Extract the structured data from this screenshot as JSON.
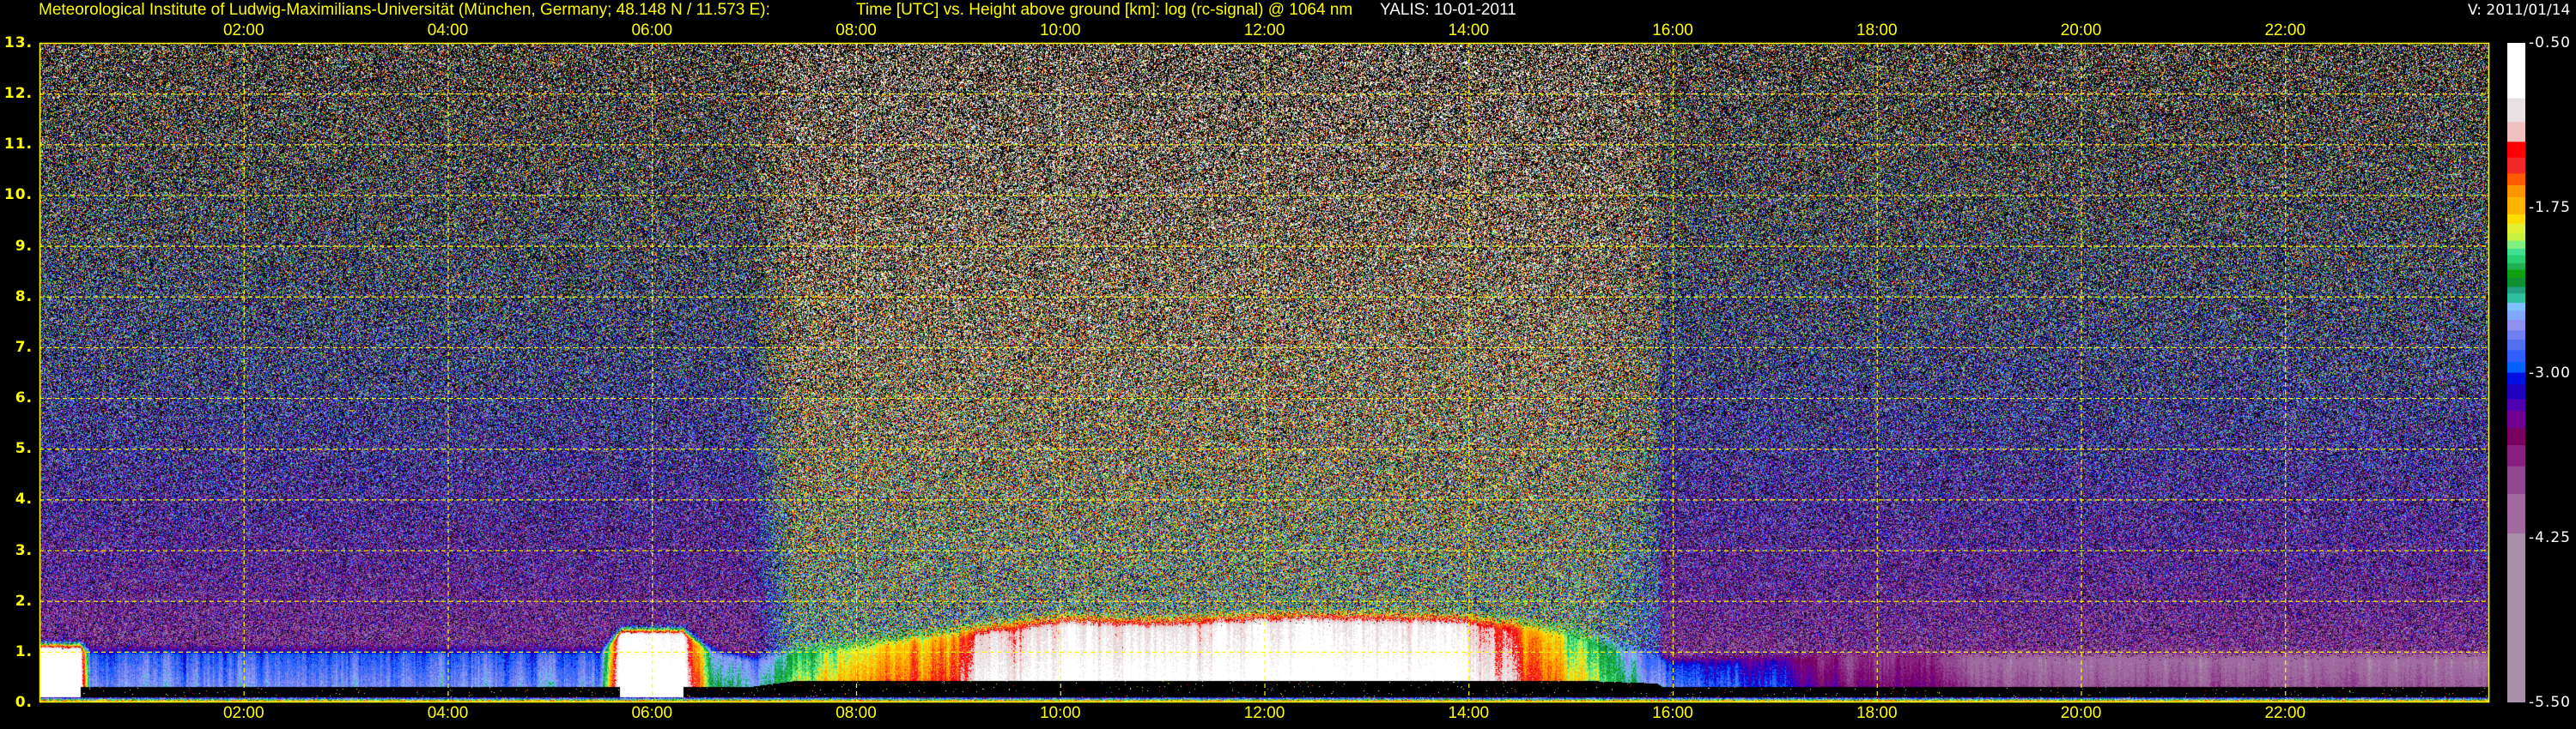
{
  "header": {
    "institute": "Meteorological Institute of Ludwig-Maximilians-Universität (München, Germany; 48.148 N / 11.573 E):",
    "title": "Time [UTC] vs. Height above ground [km]: log (rc-signal) @ 1064 nm",
    "instrument_date": "YALIS: 10-01-2011",
    "version": "V: 2011/01/14"
  },
  "chart_data": {
    "type": "heatmap",
    "title": "Time [UTC] vs. Height above ground [km]: log (rc-signal) @ 1064 nm",
    "xlabel": "Time [UTC]",
    "ylabel": "Height above ground [km]",
    "xlim": [
      0,
      24
    ],
    "ylim": [
      0,
      13
    ],
    "grid": true,
    "x_ticks": [
      {
        "value": 2,
        "label": "02:00"
      },
      {
        "value": 4,
        "label": "04:00"
      },
      {
        "value": 6,
        "label": "06:00"
      },
      {
        "value": 8,
        "label": "08:00"
      },
      {
        "value": 10,
        "label": "10:00"
      },
      {
        "value": 12,
        "label": "12:00"
      },
      {
        "value": 14,
        "label": "14:00"
      },
      {
        "value": 16,
        "label": "16:00"
      },
      {
        "value": 18,
        "label": "18:00"
      },
      {
        "value": 20,
        "label": "20:00"
      },
      {
        "value": 22,
        "label": "22:00"
      }
    ],
    "y_ticks": [
      {
        "value": 0,
        "label": "0."
      },
      {
        "value": 1,
        "label": "1."
      },
      {
        "value": 2,
        "label": "2."
      },
      {
        "value": 3,
        "label": "3."
      },
      {
        "value": 4,
        "label": "4."
      },
      {
        "value": 5,
        "label": "5."
      },
      {
        "value": 6,
        "label": "6."
      },
      {
        "value": 7,
        "label": "7."
      },
      {
        "value": 8,
        "label": "8."
      },
      {
        "value": 9,
        "label": "9."
      },
      {
        "value": 10,
        "label": "10."
      },
      {
        "value": 11,
        "label": "11."
      },
      {
        "value": 12,
        "label": "12."
      },
      {
        "value": 13,
        "label": "13."
      }
    ],
    "aerosol_layer_estimate": {
      "time_h": [
        0,
        0.4,
        0.5,
        5.5,
        5.7,
        6.3,
        6.6,
        7.0,
        7.5,
        8,
        9,
        9.2,
        10,
        11,
        12,
        13,
        14,
        14.5,
        15,
        15.5,
        16,
        16.5,
        17,
        17.5,
        18,
        18.5,
        19,
        24
      ],
      "top_km": [
        1.0,
        1.0,
        0.9,
        0.9,
        1.3,
        1.3,
        0.9,
        0.75,
        0.85,
        0.95,
        1.2,
        1.25,
        1.45,
        1.4,
        1.5,
        1.5,
        1.45,
        1.35,
        1.2,
        0.9,
        0.7,
        0.72,
        0.75,
        0.8,
        0.8,
        0.8,
        0.8,
        0.8
      ],
      "log_signal": [
        -0.6,
        -0.8,
        -2.9,
        -2.85,
        -0.7,
        -0.8,
        -2.6,
        -2.7,
        -2.1,
        -1.9,
        -1.6,
        -1.1,
        -1.0,
        -0.95,
        -0.9,
        -0.9,
        -1.0,
        -1.5,
        -2.0,
        -2.4,
        -3.0,
        -3.1,
        -3.2,
        -3.6,
        -3.7,
        -3.6,
        -4.1,
        -4.1
      ]
    },
    "colorbar": {
      "range": [
        -5.5,
        -0.5
      ],
      "tick_labels": [
        {
          "value": -0.5,
          "label": "-0.50"
        },
        {
          "value": -1.75,
          "label": "-1.75"
        },
        {
          "value": -3.0,
          "label": "-3.00"
        },
        {
          "value": -4.25,
          "label": "-4.25"
        },
        {
          "value": -5.5,
          "label": "-5.50"
        }
      ],
      "levels": [
        {
          "min": -0.92,
          "color": "#ffffff"
        },
        {
          "min": -1.1,
          "color": "#e8e0e2"
        },
        {
          "min": -1.25,
          "color": "#f0c0c0"
        },
        {
          "min": -1.37,
          "color": "#ff0000"
        },
        {
          "min": -1.49,
          "color": "#f02828"
        },
        {
          "min": -1.58,
          "color": "#ff5a00"
        },
        {
          "min": -1.67,
          "color": "#ff9600"
        },
        {
          "min": -1.8,
          "color": "#ffb400"
        },
        {
          "min": -1.87,
          "color": "#ffdc00"
        },
        {
          "min": -1.94,
          "color": "#e0f030"
        },
        {
          "min": -2.0,
          "color": "#c8f040"
        },
        {
          "min": -2.06,
          "color": "#80f080"
        },
        {
          "min": -2.11,
          "color": "#40e090"
        },
        {
          "min": -2.17,
          "color": "#28d070"
        },
        {
          "min": -2.22,
          "color": "#20b050"
        },
        {
          "min": -2.28,
          "color": "#10a010"
        },
        {
          "min": -2.35,
          "color": "#109030"
        },
        {
          "min": -2.4,
          "color": "#20a080"
        },
        {
          "min": -2.47,
          "color": "#30c0a0"
        },
        {
          "min": -2.53,
          "color": "#80c0ff"
        },
        {
          "min": -2.6,
          "color": "#80a8ff"
        },
        {
          "min": -2.68,
          "color": "#9090f0"
        },
        {
          "min": -2.75,
          "color": "#7080f0"
        },
        {
          "min": -2.83,
          "color": "#5070f0"
        },
        {
          "min": -2.92,
          "color": "#3060ff"
        },
        {
          "min": -3.0,
          "color": "#0060ff"
        },
        {
          "min": -3.09,
          "color": "#0010e0"
        },
        {
          "min": -3.2,
          "color": "#2000c0"
        },
        {
          "min": -3.29,
          "color": "#5000b0"
        },
        {
          "min": -3.42,
          "color": "#700090"
        },
        {
          "min": -3.55,
          "color": "#780060"
        },
        {
          "min": -3.71,
          "color": "#882080"
        },
        {
          "min": -3.92,
          "color": "#904890"
        },
        {
          "min": -4.22,
          "color": "#a06aa0"
        },
        {
          "min": -5.5,
          "color": "#a890a8"
        }
      ]
    }
  },
  "colors": {
    "axis": "#ffff00",
    "grid": "#ffff00",
    "background": "#000000",
    "text_white": "#ffffff"
  }
}
